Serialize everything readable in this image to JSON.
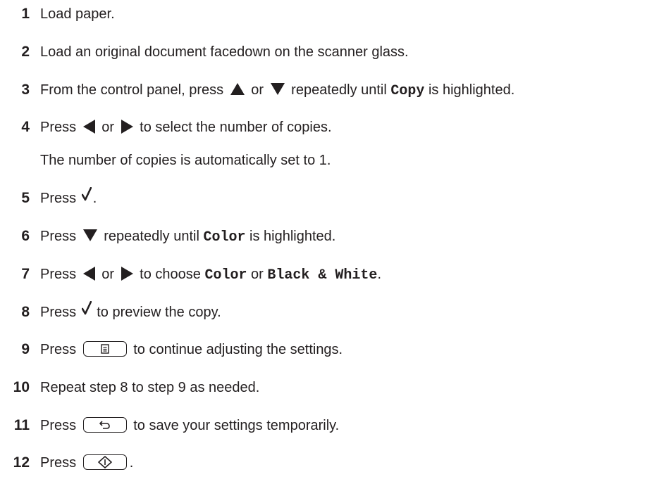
{
  "steps": [
    {
      "num": "1",
      "text": "Load paper."
    },
    {
      "num": "2",
      "text": "Load an original document facedown on the scanner glass."
    },
    {
      "num": "3",
      "a": "From the control panel, press",
      "b": "or",
      "c": "repeatedly until",
      "code": "Copy",
      "d": "is highlighted."
    },
    {
      "num": "4",
      "a": "Press",
      "b": "or",
      "c": "to select the number of copies."
    },
    {
      "note": "The number of copies is automatically set to 1."
    },
    {
      "num": "5",
      "a": "Press",
      "b": "."
    },
    {
      "num": "6",
      "a": "Press",
      "b": "repeatedly until",
      "code": "Color",
      "c": "is highlighted."
    },
    {
      "num": "7",
      "a": "Press",
      "b": "or",
      "c": "to choose",
      "code1": "Color",
      "d": "or",
      "code2": "Black & White",
      "e": "."
    },
    {
      "num": "8",
      "a": "Press",
      "b": "to preview the copy."
    },
    {
      "num": "9",
      "a": "Press",
      "b": "to continue adjusting the settings."
    },
    {
      "num": "10",
      "text": "Repeat step 8 to step 9 as needed."
    },
    {
      "num": "11",
      "a": "Press",
      "b": "to save your settings temporarily."
    },
    {
      "num": "12",
      "a": "Press",
      "b": "."
    }
  ],
  "icons": {
    "up": "up-arrow-icon",
    "down": "down-arrow-icon",
    "left": "left-arrow-icon",
    "right": "right-arrow-icon",
    "select": "checkmark-icon",
    "menu": "menu-button-icon",
    "back": "back-button-icon",
    "start": "start-button-icon"
  },
  "colors": {
    "text": "#231f20"
  }
}
